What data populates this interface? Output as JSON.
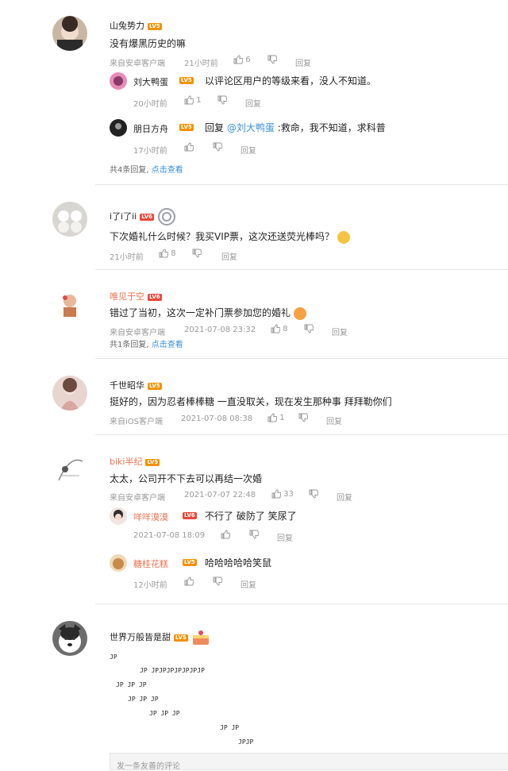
{
  "comments": [
    {
      "user": "山兔势力",
      "level": "LV5",
      "text": "没有爆黑历史的嘛",
      "source": "来自安卓客户端",
      "time": "21小时前",
      "likes": "6",
      "reply": "回复",
      "replies": [
        {
          "user": "刘大鸭蛋",
          "level": "LV5",
          "text": "以评论区用户的等级来看，没人不知道。",
          "time": "20小时前",
          "likes": "1",
          "reply": "回复"
        },
        {
          "user": "朋日方舟",
          "level": "LV5",
          "prefix": "回复",
          "mention": "@刘大鸭蛋",
          "text": ":救命，我不知道，求科普",
          "time": "17小时前",
          "likes": "",
          "reply": "回复"
        }
      ],
      "more_prefix": "共4条回复,",
      "more_link": "点击查看"
    },
    {
      "user": "i了i了ii",
      "level": "LV6",
      "text": "下次婚礼什么时候？我买VIP票，这次还送荧光棒吗？",
      "source": "",
      "time": "21小时前",
      "likes": "8",
      "reply": "回复"
    },
    {
      "user": "唯见于空",
      "level": "LV6",
      "text": "错过了当初，这次一定补门票参加您的婚礼",
      "source": "来自安卓客户端",
      "time": "2021-07-08 23:32",
      "likes": "8",
      "reply": "回复",
      "more_prefix": "共1条回复,",
      "more_link": "点击查看"
    },
    {
      "user": "千世昭华",
      "level": "LV5",
      "text": "挺好的，因为忍者棒棒糖 一直没取关，现在发生那种事 拜拜勒你们",
      "source": "来自iOS客户端",
      "time": "2021-07-08 08:38",
      "likes": "1",
      "reply": "回复"
    },
    {
      "user": "biki半纪",
      "level": "LV5",
      "text": "太太，公司开不下去可以再结一次婚",
      "source": "来自安卓客户端",
      "time": "2021-07-07 22:48",
      "likes": "33",
      "reply": "回复",
      "replies": [
        {
          "user": "咩咩漠漠",
          "level": "LV6",
          "text": "不行了 破防了 笑尿了",
          "time": "2021-07-08 18:09",
          "likes": "",
          "reply": "回复"
        },
        {
          "user": "糖桂花糕",
          "level": "LV5",
          "text": "哈哈哈哈哈笑鼠",
          "time": "12小时前",
          "likes": "",
          "reply": "回复"
        }
      ]
    },
    {
      "user": "世界万般皆是甜",
      "level": "LV5",
      "jp_lines": [
        "JP",
        "JP              JPJPJPJPJPJPJP",
        "JP                        JP                              JP",
        "JP                      JP                          JP",
        "JP                   JP                    JP",
        "JP                  JP",
        "JPJP"
      ]
    }
  ],
  "input_placeholder": "发一条友善的评论"
}
